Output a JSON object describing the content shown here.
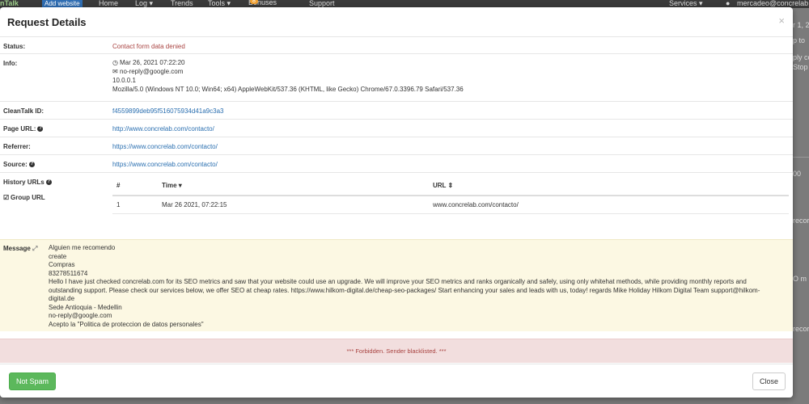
{
  "background": {
    "brand": "nTalk",
    "add_website": "Add website",
    "nav": [
      "Home",
      "Log ▾",
      "Trends",
      "Tools ▾",
      "Bonuses",
      "Support"
    ],
    "bonus_count": "8",
    "services": "Services ▾",
    "user_email": "mercadeo@concrelab",
    "side_texts": [
      "r 1, 2",
      "p to",
      "ply co",
      "Stop",
      "00",
      "recor",
      "O m",
      "recor"
    ]
  },
  "modal": {
    "title": "Request Details",
    "close_icon": "×",
    "status": {
      "label": "Status:",
      "value": "Contact form data denied"
    },
    "info": {
      "label": "Info:",
      "datetime": "Mar 26, 2021 07:22:20",
      "email": "no-reply@google.com",
      "ip": "10.0.0.1",
      "user_agent": "Mozilla/5.0 (Windows NT 10.0; Win64; x64) AppleWebKit/537.36 (KHTML, like Gecko) Chrome/67.0.3396.79 Safari/537.36"
    },
    "cleantalk_id": {
      "label": "CleanTalk ID:",
      "value": "f4559899deb95f516075934d41a9c3a3"
    },
    "page_url": {
      "label": "Page URL:",
      "value": "http://www.concrelab.com/contacto/"
    },
    "referrer": {
      "label": "Referrer:",
      "value": "https://www.concrelab.com/contacto/"
    },
    "source": {
      "label": "Source:",
      "value": "https://www.concrelab.com/contacto/"
    },
    "history": {
      "label": "History URLs",
      "group_url": "Group URL",
      "columns": [
        "#",
        "Time ▾",
        "URL ⇕"
      ],
      "rows": [
        {
          "num": "1",
          "time": "Mar 26 2021, 07:22:15",
          "url": "www.concrelab.com/contacto/"
        }
      ]
    },
    "message": {
      "label": "Message",
      "lines": [
        "Alguien me recomendo",
        "create",
        "Compras",
        "83278511674",
        "Hello I have just checked concrelab.com for its SEO metrics and saw that your website could use an upgrade. We will improve your SEO metrics and ranks organically and safely, using only whitehat methods, while providing monthly reports and outstanding support. Please check our services below, we offer SEO at cheap rates. https://www.hilkom-digital.de/cheap-seo-packages/ Start enhancing your sales and leads with us, today! regards Mike Holiday Hilkom Digital Team support@hilkom-digital.de",
        "Sede Antioquia - Medellin",
        "no-reply@google.com",
        "Acepto la \"Politica de proteccion de datos personales\""
      ]
    },
    "alert": "*** Forbidden. Sender blacklisted. ***",
    "buttons": {
      "not_spam": "Not Spam",
      "close": "Close"
    }
  },
  "colors": {
    "green": "#5cb85c",
    "alert_red": "#a94442",
    "link_blue": "#2a6fb0",
    "message_bg": "#fcf8e3",
    "alert_bg": "#f2dede"
  }
}
